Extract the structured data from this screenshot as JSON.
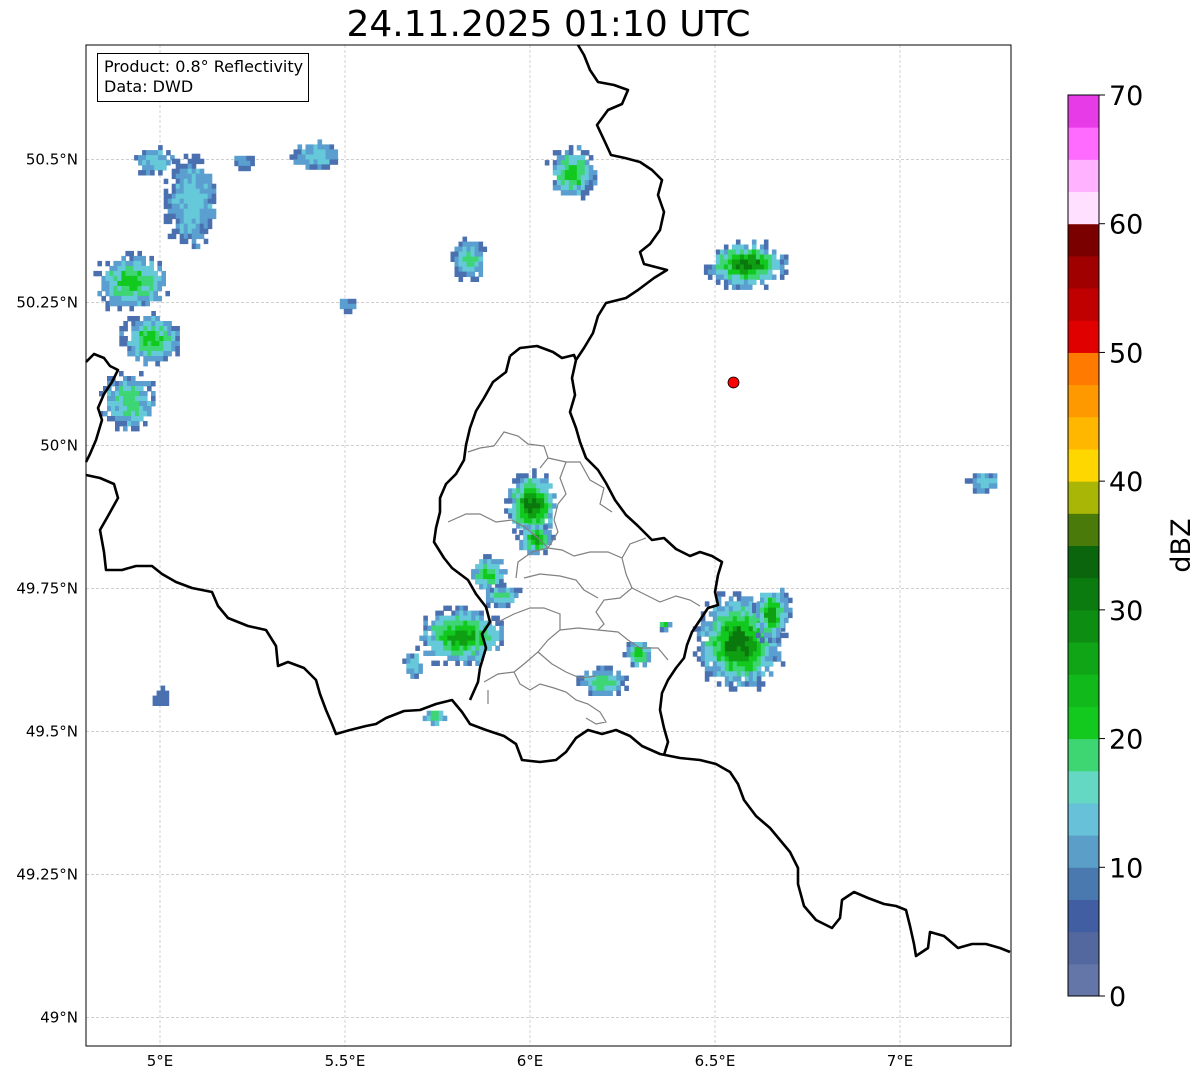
{
  "title": "24.11.2025 01:10 UTC",
  "info": {
    "product": "Product: 0.8° Reflectivity",
    "data": "Data: DWD"
  },
  "map": {
    "lon_range": [
      4.8,
      7.3
    ],
    "lat_range": [
      48.95,
      50.7
    ],
    "lon_ticks": [
      {
        "value": 5.0,
        "label": "5°E"
      },
      {
        "value": 5.5,
        "label": "5.5°E"
      },
      {
        "value": 6.0,
        "label": "6°E"
      },
      {
        "value": 6.5,
        "label": "6.5°E"
      },
      {
        "value": 7.0,
        "label": "7°E"
      }
    ],
    "lat_ticks": [
      {
        "value": 49.0,
        "label": "49°N"
      },
      {
        "value": 49.25,
        "label": "49.25°N"
      },
      {
        "value": 49.5,
        "label": "49.5°N"
      },
      {
        "value": 49.75,
        "label": "49.75°N"
      },
      {
        "value": 50.0,
        "label": "50°N"
      },
      {
        "value": 50.25,
        "label": "50.25°N"
      },
      {
        "value": 50.5,
        "label": "50.5°N"
      }
    ],
    "grid": true,
    "radar_site": {
      "lon": 6.55,
      "lat": 50.11,
      "color": "#ff0000"
    },
    "echo_colors": [
      "#4a70b0",
      "#5a9fd0",
      "#66c9d9",
      "#3ed574",
      "#12c91e",
      "#0f9f12",
      "#0b780d"
    ],
    "echoes": [
      {
        "lon": 4.98,
        "lat": 50.5,
        "w": 0.1,
        "h": 0.05,
        "maxc": 2
      },
      {
        "lon": 5.08,
        "lat": 50.43,
        "w": 0.14,
        "h": 0.16,
        "maxc": 2
      },
      {
        "lon": 5.22,
        "lat": 50.5,
        "w": 0.06,
        "h": 0.03,
        "maxc": 1
      },
      {
        "lon": 5.42,
        "lat": 50.51,
        "w": 0.14,
        "h": 0.05,
        "maxc": 2
      },
      {
        "lon": 4.92,
        "lat": 50.29,
        "w": 0.2,
        "h": 0.1,
        "maxc": 4
      },
      {
        "lon": 4.97,
        "lat": 50.19,
        "w": 0.16,
        "h": 0.09,
        "maxc": 4
      },
      {
        "lon": 4.91,
        "lat": 50.08,
        "w": 0.15,
        "h": 0.1,
        "maxc": 3
      },
      {
        "lon": 5.5,
        "lat": 50.25,
        "w": 0.05,
        "h": 0.03,
        "maxc": 1
      },
      {
        "lon": 5.83,
        "lat": 50.33,
        "w": 0.09,
        "h": 0.07,
        "maxc": 3
      },
      {
        "lon": 6.11,
        "lat": 50.48,
        "w": 0.14,
        "h": 0.09,
        "maxc": 4
      },
      {
        "lon": 6.58,
        "lat": 50.32,
        "w": 0.22,
        "h": 0.08,
        "maxc": 6
      },
      {
        "lon": 7.22,
        "lat": 49.94,
        "w": 0.09,
        "h": 0.04,
        "maxc": 2
      },
      {
        "lon": 6.0,
        "lat": 49.9,
        "w": 0.14,
        "h": 0.12,
        "maxc": 6
      },
      {
        "lon": 6.01,
        "lat": 49.84,
        "w": 0.1,
        "h": 0.06,
        "maxc": 5
      },
      {
        "lon": 5.88,
        "lat": 49.78,
        "w": 0.1,
        "h": 0.06,
        "maxc": 4
      },
      {
        "lon": 5.92,
        "lat": 49.74,
        "w": 0.1,
        "h": 0.04,
        "maxc": 3
      },
      {
        "lon": 5.81,
        "lat": 49.67,
        "w": 0.24,
        "h": 0.1,
        "maxc": 5
      },
      {
        "lon": 5.68,
        "lat": 49.62,
        "w": 0.05,
        "h": 0.05,
        "maxc": 2
      },
      {
        "lon": 5.74,
        "lat": 49.53,
        "w": 0.06,
        "h": 0.03,
        "maxc": 3
      },
      {
        "lon": 5.0,
        "lat": 49.56,
        "w": 0.04,
        "h": 0.04,
        "maxc": 0
      },
      {
        "lon": 6.29,
        "lat": 49.64,
        "w": 0.08,
        "h": 0.05,
        "maxc": 4
      },
      {
        "lon": 6.36,
        "lat": 49.69,
        "w": 0.04,
        "h": 0.02,
        "maxc": 4
      },
      {
        "lon": 6.19,
        "lat": 49.59,
        "w": 0.13,
        "h": 0.05,
        "maxc": 3
      },
      {
        "lon": 6.56,
        "lat": 49.66,
        "w": 0.24,
        "h": 0.17,
        "maxc": 6
      },
      {
        "lon": 6.65,
        "lat": 49.71,
        "w": 0.1,
        "h": 0.1,
        "maxc": 5
      }
    ]
  },
  "colorbar": {
    "label": "dBZ",
    "vmin": 0,
    "vmax": 70,
    "tick_labels": [
      "0",
      "10",
      "20",
      "30",
      "40",
      "50",
      "60",
      "70"
    ],
    "colors": [
      "#6475a8",
      "#53689e",
      "#425ea2",
      "#4a79b0",
      "#5b9ec7",
      "#66c1d9",
      "#64d8c2",
      "#3dd672",
      "#13c91e",
      "#12b91b",
      "#10a516",
      "#0d8e12",
      "#0b7a0f",
      "#0a650c",
      "#4a7a09",
      "#aab606",
      "#ffd700",
      "#ffb700",
      "#ff9900",
      "#ff7a00",
      "#e00000",
      "#c00000",
      "#a00000",
      "#7a0000",
      "#ffe0ff",
      "#ffb2ff",
      "#ff6bff",
      "#e83be8"
    ]
  }
}
